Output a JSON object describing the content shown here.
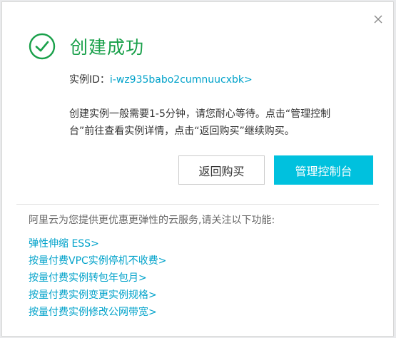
{
  "dialog": {
    "title": "创建成功",
    "instance_label": "实例ID：",
    "instance_id": "i-wz935babo2cumnuucxbk>",
    "description": "创建实例一般需要1-5分钟，请您耐心等待。点击“管理控制台”前往查看实例详情，点击“返回购买”继续购买。",
    "buttons": {
      "return_label": "返回购买",
      "console_label": "管理控制台"
    },
    "notice": "阿里云为您提供更优惠更弹性的云服务,请关注以下功能:",
    "features": [
      "弹性伸缩 ESS>",
      "按量付费VPC实例停机不收费>",
      "按量付费实例转包年包月>",
      "按量付费实例变更实例规格>",
      "按量付费实例修改公网带宽>"
    ]
  },
  "icons": {
    "success": "check-circle-icon",
    "close": "close-icon"
  },
  "colors": {
    "success_green": "#19a04a",
    "link_blue": "#00a2ca",
    "primary_button": "#00c1de"
  }
}
